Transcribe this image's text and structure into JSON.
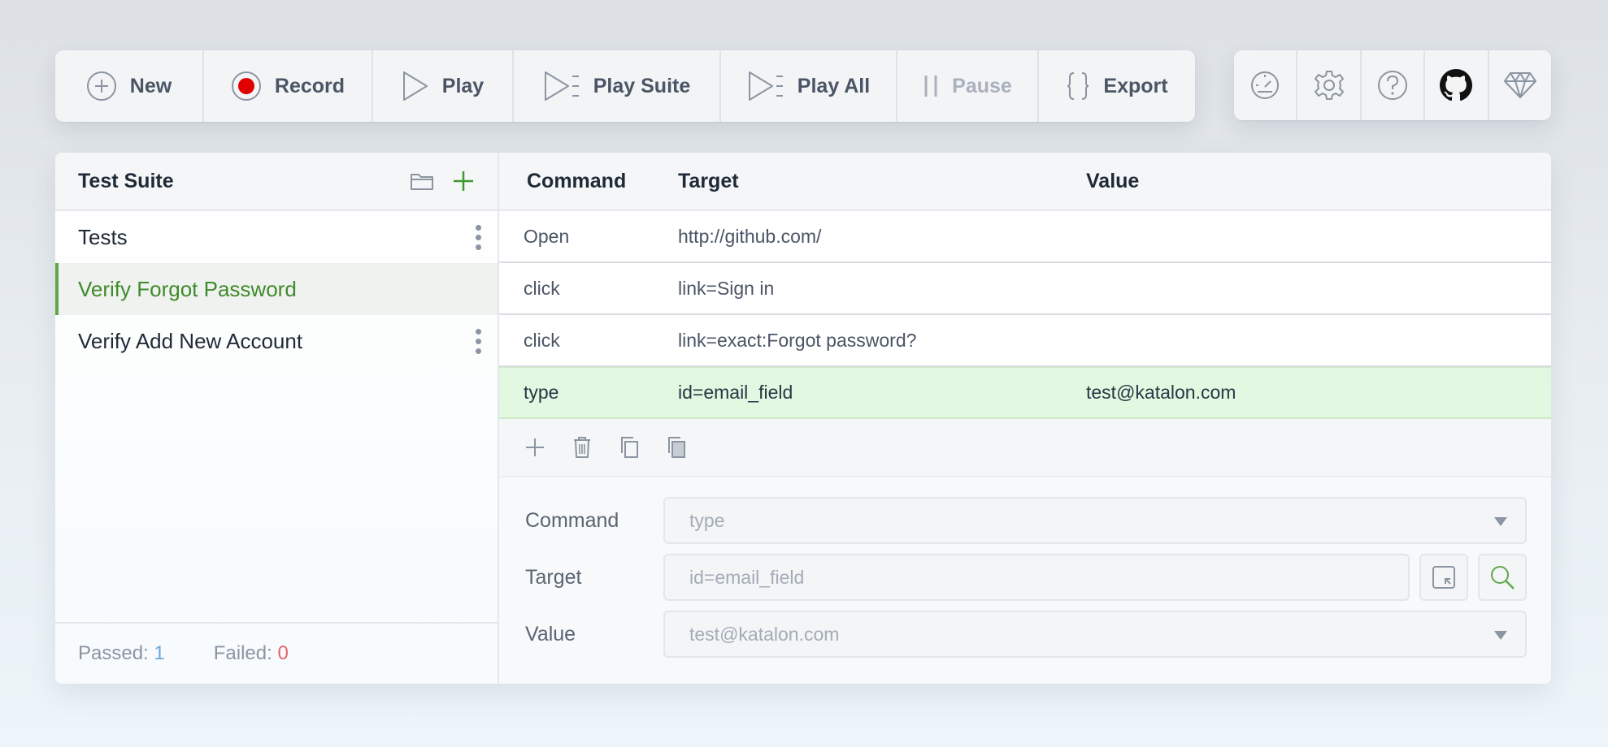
{
  "toolbar": {
    "new_label": "New",
    "record_label": "Record",
    "play_label": "Play",
    "play_suite_label": "Play Suite",
    "play_all_label": "Play All",
    "pause_label": "Pause",
    "export_label": "Export"
  },
  "iconbar": {
    "icons": [
      "speedometer-icon",
      "gear-icon",
      "help-icon",
      "github-icon",
      "diamond-icon"
    ]
  },
  "sidebar": {
    "title": "Test Suite",
    "items": [
      {
        "label": "Tests",
        "selected": false
      },
      {
        "label": "Verify Forgot Password",
        "selected": true
      },
      {
        "label": "Verify Add New Account",
        "selected": false
      }
    ],
    "passed_label": "Passed:",
    "passed_count": "1",
    "failed_label": "Failed:",
    "failed_count": "0"
  },
  "table": {
    "headers": {
      "command": "Command",
      "target": "Target",
      "value": "Value"
    },
    "rows": [
      {
        "command": "Open",
        "target": "http://github.com/",
        "value": ""
      },
      {
        "command": "click",
        "target": "link=Sign in",
        "value": ""
      },
      {
        "command": "click",
        "target": "link=exact:Forgot password?",
        "value": ""
      },
      {
        "command": "type",
        "target": "id=email_field",
        "value": "test@katalon.com"
      }
    ]
  },
  "editor": {
    "command_label": "Command",
    "command_value": "type",
    "target_label": "Target",
    "target_value": "id=email_field",
    "value_label": "Value",
    "value_value": "test@katalon.com"
  },
  "colors": {
    "accent_green": "#5fa84a",
    "selected_row": "#e2f8e0",
    "record_red": "#e00000",
    "passed_blue": "#6aa8e0",
    "failed_red": "#e56363"
  }
}
